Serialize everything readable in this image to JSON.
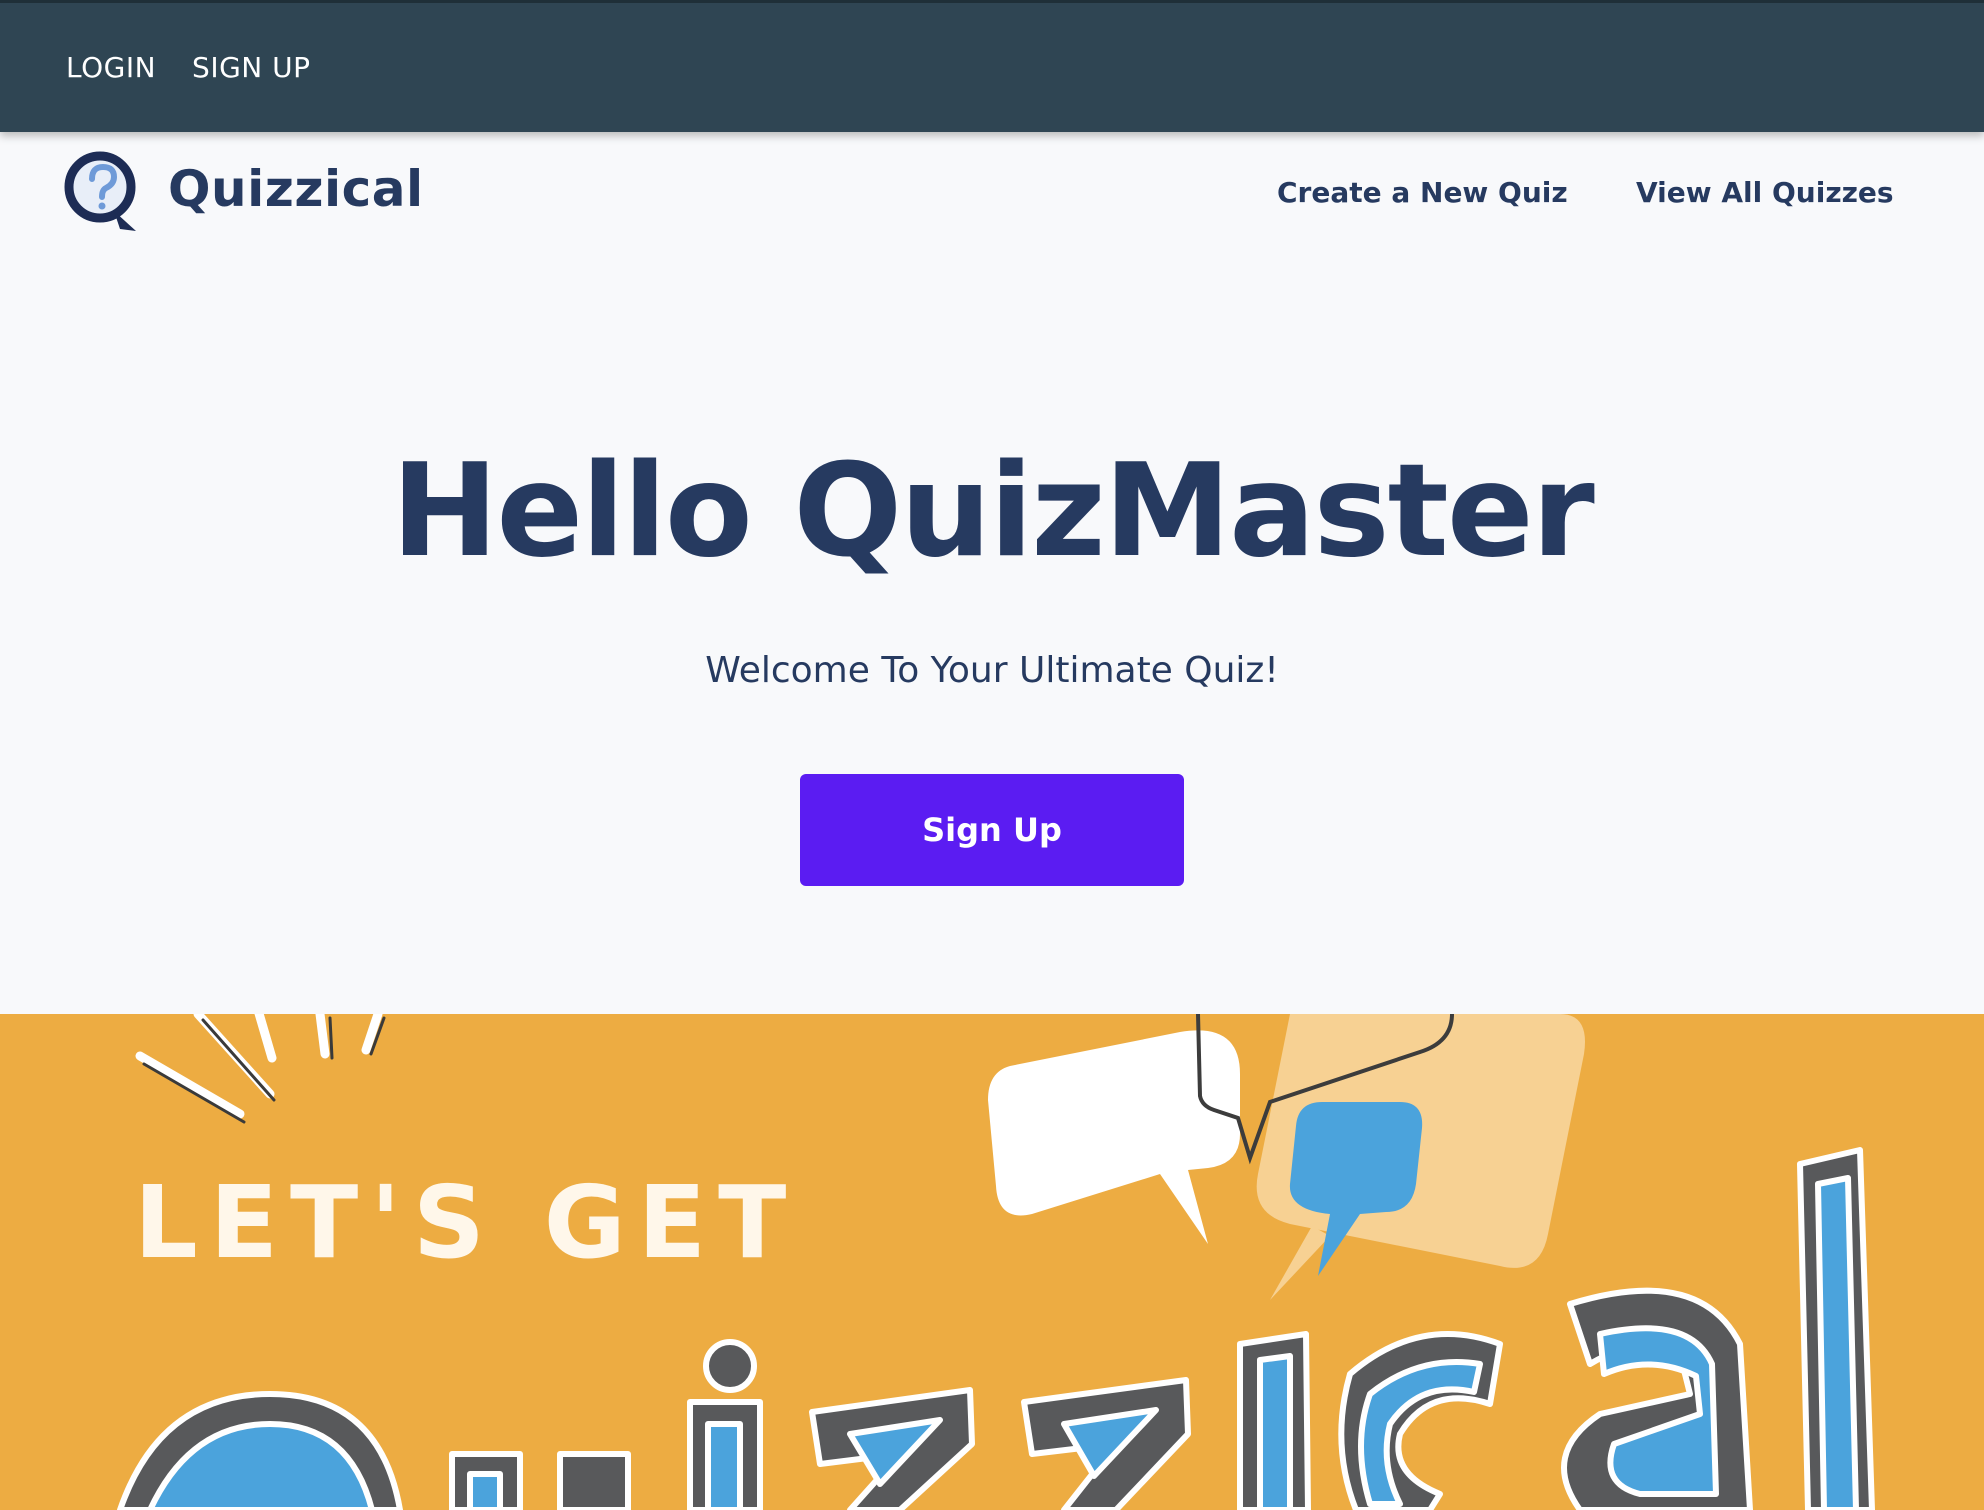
{
  "auth_bar": {
    "login_label": "LOGIN",
    "signup_label": "SIGN UP"
  },
  "brand": {
    "name": "Quizzical",
    "logo_icon": "question-bubble-icon"
  },
  "nav": {
    "create_label": "Create a New Quiz",
    "view_label": "View All Quizzes"
  },
  "hero": {
    "title": "Hello QuizMaster",
    "subtitle": "Welcome To Your Ultimate Quiz!",
    "button_label": "Sign Up"
  },
  "banner": {
    "tagline": "LET'S GET",
    "word": "Quizzical"
  },
  "colors": {
    "auth_bar_bg": "#2f4553",
    "page_bg": "#f8f9fb",
    "text_primary": "#263a60",
    "button_bg": "#5b1cf2",
    "banner_bg": "#edac42",
    "banner_blue": "#4ba3dc"
  }
}
